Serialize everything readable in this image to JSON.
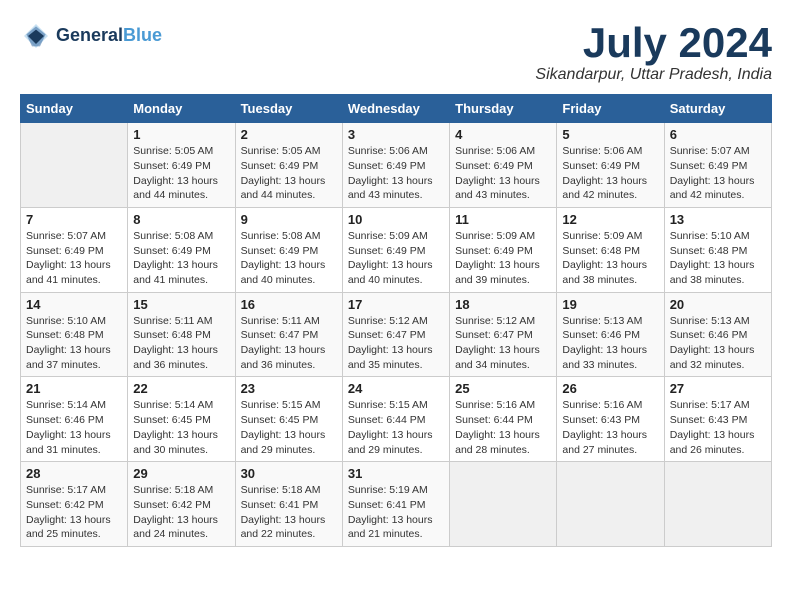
{
  "header": {
    "logo_line1": "General",
    "logo_line2": "Blue",
    "month_year": "July 2024",
    "location": "Sikandarpur, Uttar Pradesh, India"
  },
  "weekdays": [
    "Sunday",
    "Monday",
    "Tuesday",
    "Wednesday",
    "Thursday",
    "Friday",
    "Saturday"
  ],
  "weeks": [
    [
      {
        "day": "",
        "sunrise": "",
        "sunset": "",
        "daylight": ""
      },
      {
        "day": "1",
        "sunrise": "Sunrise: 5:05 AM",
        "sunset": "Sunset: 6:49 PM",
        "daylight": "Daylight: 13 hours and 44 minutes."
      },
      {
        "day": "2",
        "sunrise": "Sunrise: 5:05 AM",
        "sunset": "Sunset: 6:49 PM",
        "daylight": "Daylight: 13 hours and 44 minutes."
      },
      {
        "day": "3",
        "sunrise": "Sunrise: 5:06 AM",
        "sunset": "Sunset: 6:49 PM",
        "daylight": "Daylight: 13 hours and 43 minutes."
      },
      {
        "day": "4",
        "sunrise": "Sunrise: 5:06 AM",
        "sunset": "Sunset: 6:49 PM",
        "daylight": "Daylight: 13 hours and 43 minutes."
      },
      {
        "day": "5",
        "sunrise": "Sunrise: 5:06 AM",
        "sunset": "Sunset: 6:49 PM",
        "daylight": "Daylight: 13 hours and 42 minutes."
      },
      {
        "day": "6",
        "sunrise": "Sunrise: 5:07 AM",
        "sunset": "Sunset: 6:49 PM",
        "daylight": "Daylight: 13 hours and 42 minutes."
      }
    ],
    [
      {
        "day": "7",
        "sunrise": "Sunrise: 5:07 AM",
        "sunset": "Sunset: 6:49 PM",
        "daylight": "Daylight: 13 hours and 41 minutes."
      },
      {
        "day": "8",
        "sunrise": "Sunrise: 5:08 AM",
        "sunset": "Sunset: 6:49 PM",
        "daylight": "Daylight: 13 hours and 41 minutes."
      },
      {
        "day": "9",
        "sunrise": "Sunrise: 5:08 AM",
        "sunset": "Sunset: 6:49 PM",
        "daylight": "Daylight: 13 hours and 40 minutes."
      },
      {
        "day": "10",
        "sunrise": "Sunrise: 5:09 AM",
        "sunset": "Sunset: 6:49 PM",
        "daylight": "Daylight: 13 hours and 40 minutes."
      },
      {
        "day": "11",
        "sunrise": "Sunrise: 5:09 AM",
        "sunset": "Sunset: 6:49 PM",
        "daylight": "Daylight: 13 hours and 39 minutes."
      },
      {
        "day": "12",
        "sunrise": "Sunrise: 5:09 AM",
        "sunset": "Sunset: 6:48 PM",
        "daylight": "Daylight: 13 hours and 38 minutes."
      },
      {
        "day": "13",
        "sunrise": "Sunrise: 5:10 AM",
        "sunset": "Sunset: 6:48 PM",
        "daylight": "Daylight: 13 hours and 38 minutes."
      }
    ],
    [
      {
        "day": "14",
        "sunrise": "Sunrise: 5:10 AM",
        "sunset": "Sunset: 6:48 PM",
        "daylight": "Daylight: 13 hours and 37 minutes."
      },
      {
        "day": "15",
        "sunrise": "Sunrise: 5:11 AM",
        "sunset": "Sunset: 6:48 PM",
        "daylight": "Daylight: 13 hours and 36 minutes."
      },
      {
        "day": "16",
        "sunrise": "Sunrise: 5:11 AM",
        "sunset": "Sunset: 6:47 PM",
        "daylight": "Daylight: 13 hours and 36 minutes."
      },
      {
        "day": "17",
        "sunrise": "Sunrise: 5:12 AM",
        "sunset": "Sunset: 6:47 PM",
        "daylight": "Daylight: 13 hours and 35 minutes."
      },
      {
        "day": "18",
        "sunrise": "Sunrise: 5:12 AM",
        "sunset": "Sunset: 6:47 PM",
        "daylight": "Daylight: 13 hours and 34 minutes."
      },
      {
        "day": "19",
        "sunrise": "Sunrise: 5:13 AM",
        "sunset": "Sunset: 6:46 PM",
        "daylight": "Daylight: 13 hours and 33 minutes."
      },
      {
        "day": "20",
        "sunrise": "Sunrise: 5:13 AM",
        "sunset": "Sunset: 6:46 PM",
        "daylight": "Daylight: 13 hours and 32 minutes."
      }
    ],
    [
      {
        "day": "21",
        "sunrise": "Sunrise: 5:14 AM",
        "sunset": "Sunset: 6:46 PM",
        "daylight": "Daylight: 13 hours and 31 minutes."
      },
      {
        "day": "22",
        "sunrise": "Sunrise: 5:14 AM",
        "sunset": "Sunset: 6:45 PM",
        "daylight": "Daylight: 13 hours and 30 minutes."
      },
      {
        "day": "23",
        "sunrise": "Sunrise: 5:15 AM",
        "sunset": "Sunset: 6:45 PM",
        "daylight": "Daylight: 13 hours and 29 minutes."
      },
      {
        "day": "24",
        "sunrise": "Sunrise: 5:15 AM",
        "sunset": "Sunset: 6:44 PM",
        "daylight": "Daylight: 13 hours and 29 minutes."
      },
      {
        "day": "25",
        "sunrise": "Sunrise: 5:16 AM",
        "sunset": "Sunset: 6:44 PM",
        "daylight": "Daylight: 13 hours and 28 minutes."
      },
      {
        "day": "26",
        "sunrise": "Sunrise: 5:16 AM",
        "sunset": "Sunset: 6:43 PM",
        "daylight": "Daylight: 13 hours and 27 minutes."
      },
      {
        "day": "27",
        "sunrise": "Sunrise: 5:17 AM",
        "sunset": "Sunset: 6:43 PM",
        "daylight": "Daylight: 13 hours and 26 minutes."
      }
    ],
    [
      {
        "day": "28",
        "sunrise": "Sunrise: 5:17 AM",
        "sunset": "Sunset: 6:42 PM",
        "daylight": "Daylight: 13 hours and 25 minutes."
      },
      {
        "day": "29",
        "sunrise": "Sunrise: 5:18 AM",
        "sunset": "Sunset: 6:42 PM",
        "daylight": "Daylight: 13 hours and 24 minutes."
      },
      {
        "day": "30",
        "sunrise": "Sunrise: 5:18 AM",
        "sunset": "Sunset: 6:41 PM",
        "daylight": "Daylight: 13 hours and 22 minutes."
      },
      {
        "day": "31",
        "sunrise": "Sunrise: 5:19 AM",
        "sunset": "Sunset: 6:41 PM",
        "daylight": "Daylight: 13 hours and 21 minutes."
      },
      {
        "day": "",
        "sunrise": "",
        "sunset": "",
        "daylight": ""
      },
      {
        "day": "",
        "sunrise": "",
        "sunset": "",
        "daylight": ""
      },
      {
        "day": "",
        "sunrise": "",
        "sunset": "",
        "daylight": ""
      }
    ]
  ]
}
